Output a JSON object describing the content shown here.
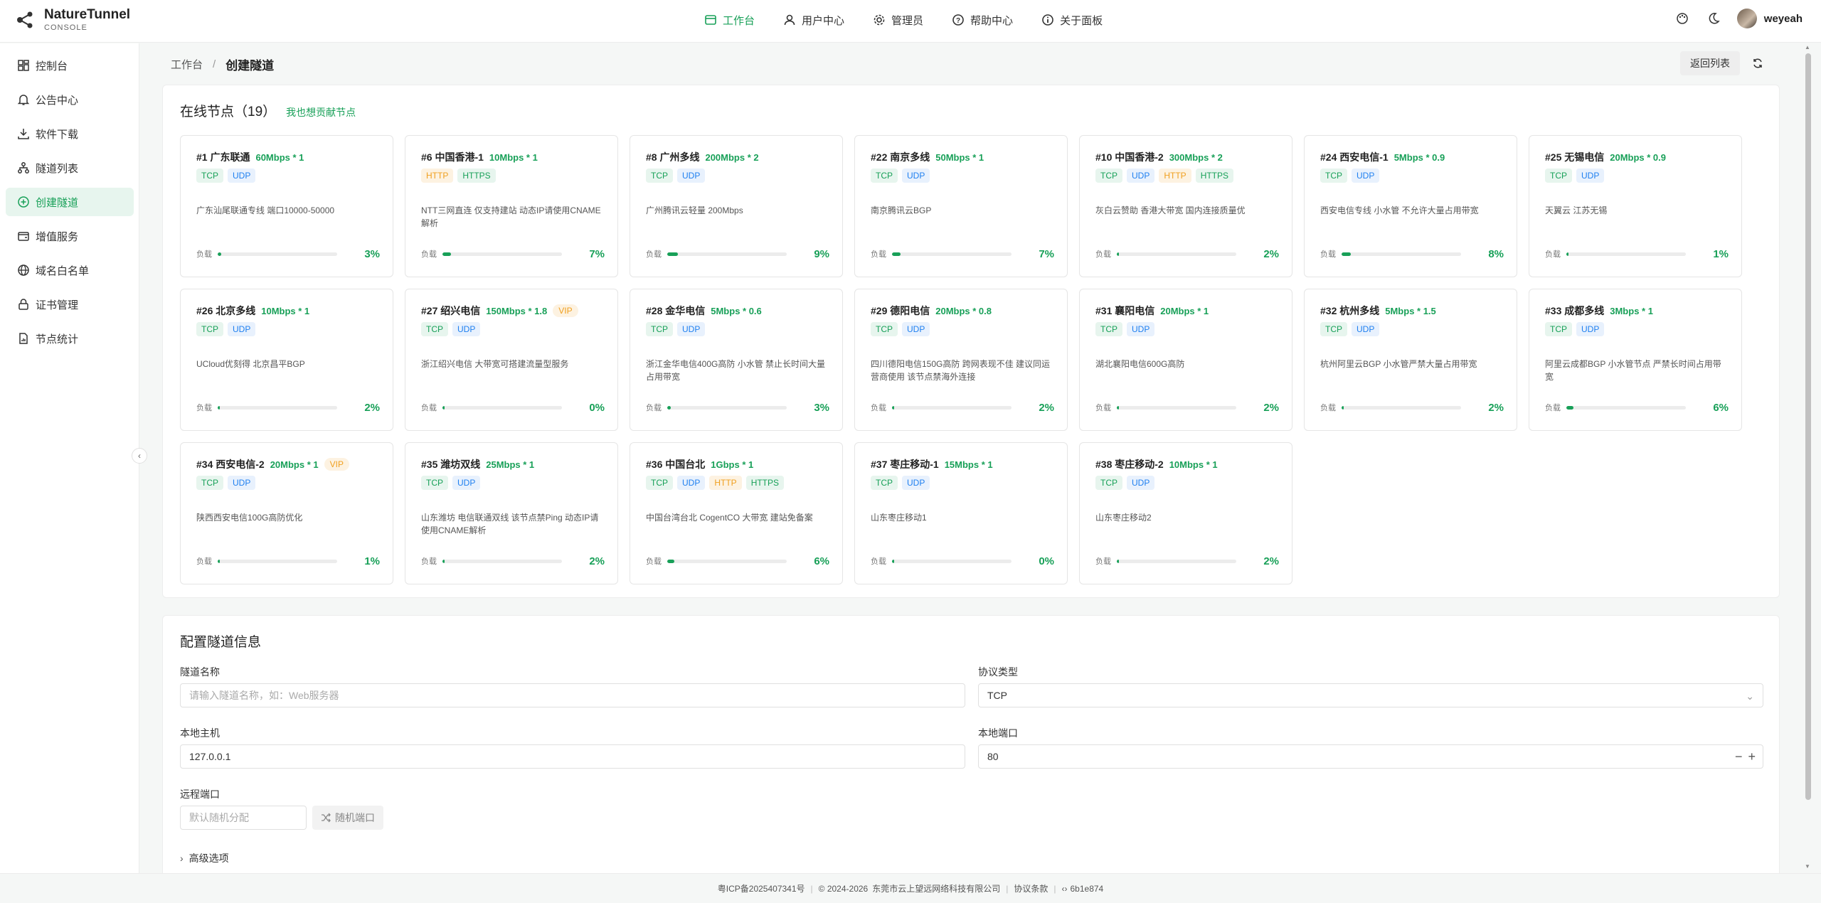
{
  "brand": {
    "name": "NatureTunnel",
    "sub": "CONSOLE"
  },
  "topnav": [
    {
      "label": "工作台",
      "icon": "dashboard-icon",
      "active": true
    },
    {
      "label": "用户中心",
      "icon": "user-icon",
      "active": false
    },
    {
      "label": "管理员",
      "icon": "gear-icon",
      "active": false
    },
    {
      "label": "帮助中心",
      "icon": "help-icon",
      "active": false
    },
    {
      "label": "关于面板",
      "icon": "info-icon",
      "active": false
    }
  ],
  "user": {
    "name": "weyeah"
  },
  "sidebar": {
    "items": [
      {
        "label": "控制台",
        "icon": "grid-icon"
      },
      {
        "label": "公告中心",
        "icon": "bell-icon"
      },
      {
        "label": "软件下载",
        "icon": "download-icon"
      },
      {
        "label": "隧道列表",
        "icon": "tree-icon"
      },
      {
        "label": "创建隧道",
        "icon": "plus-circle-icon",
        "active": true
      },
      {
        "label": "增值服务",
        "icon": "wallet-icon"
      },
      {
        "label": "域名白名单",
        "icon": "globe-icon"
      },
      {
        "label": "证书管理",
        "icon": "lock-icon"
      },
      {
        "label": "节点统计",
        "icon": "file-chart-icon"
      }
    ]
  },
  "breadcrumb": {
    "home": "工作台",
    "sep": "/",
    "current": "创建隧道"
  },
  "actions": {
    "back_label": "返回列表"
  },
  "nodes_section": {
    "title": "在线节点（19）",
    "contribute_link": "我也想贡献节点",
    "load_label": "负载"
  },
  "nodes": [
    {
      "name": "#1 广东联通",
      "bw": "60Mbps * 1",
      "vip": "",
      "tags": [
        "TCP",
        "UDP"
      ],
      "desc": "广东汕尾联通专线 端口10000-50000",
      "load": 3
    },
    {
      "name": "#6 中国香港-1",
      "bw": "10Mbps * 1",
      "vip": "",
      "tags": [
        "HTTP",
        "HTTPS"
      ],
      "desc": "NTT三网直连 仅支持建站 动态IP请使用CNAME解析",
      "load": 7
    },
    {
      "name": "#8 广州多线",
      "bw": "200Mbps * 2",
      "vip": "",
      "tags": [
        "TCP",
        "UDP"
      ],
      "desc": "广州腾讯云轻量 200Mbps",
      "load": 9
    },
    {
      "name": "#22 南京多线",
      "bw": "50Mbps * 1",
      "vip": "",
      "tags": [
        "TCP",
        "UDP"
      ],
      "desc": "南京腾讯云BGP",
      "load": 7
    },
    {
      "name": "#10 中国香港-2",
      "bw": "300Mbps * 2",
      "vip": "",
      "tags": [
        "TCP",
        "UDP",
        "HTTP",
        "HTTPS"
      ],
      "desc": "灰白云赞助 香港大带宽 国内连接质量优",
      "load": 2
    },
    {
      "name": "#24 西安电信-1",
      "bw": "5Mbps * 0.9",
      "vip": "",
      "tags": [
        "TCP",
        "UDP"
      ],
      "desc": "西安电信专线 小水管 不允许大量占用带宽",
      "load": 8
    },
    {
      "name": "#25 无锡电信",
      "bw": "20Mbps * 0.9",
      "vip": "",
      "tags": [
        "TCP",
        "UDP"
      ],
      "desc": "天翼云 江苏无锡",
      "load": 1
    },
    {
      "name": "#26 北京多线",
      "bw": "10Mbps * 1",
      "vip": "",
      "tags": [
        "TCP",
        "UDP"
      ],
      "desc": "UCloud优刻得 北京昌平BGP",
      "load": 2
    },
    {
      "name": "#27 绍兴电信",
      "bw": "150Mbps * 1.8",
      "vip": "VIP",
      "tags": [
        "TCP",
        "UDP"
      ],
      "desc": "浙江绍兴电信 大带宽可搭建流量型服务",
      "load": 0
    },
    {
      "name": "#28 金华电信",
      "bw": "5Mbps * 0.6",
      "vip": "",
      "tags": [
        "TCP",
        "UDP"
      ],
      "desc": "浙江金华电信400G高防 小水管 禁止长时间大量占用带宽",
      "load": 3
    },
    {
      "name": "#29 德阳电信",
      "bw": "20Mbps * 0.8",
      "vip": "",
      "tags": [
        "TCP",
        "UDP"
      ],
      "desc": "四川德阳电信150G高防 跨网表现不佳 建议同运营商使用 该节点禁海外连接",
      "load": 2
    },
    {
      "name": "#31 襄阳电信",
      "bw": "20Mbps * 1",
      "vip": "",
      "tags": [
        "TCP",
        "UDP"
      ],
      "desc": "湖北襄阳电信600G高防",
      "load": 2
    },
    {
      "name": "#32 杭州多线",
      "bw": "5Mbps * 1.5",
      "vip": "",
      "tags": [
        "TCP",
        "UDP"
      ],
      "desc": "杭州阿里云BGP 小水管严禁大量占用带宽",
      "load": 2
    },
    {
      "name": "#33 成都多线",
      "bw": "3Mbps * 1",
      "vip": "",
      "tags": [
        "TCP",
        "UDP"
      ],
      "desc": "阿里云成都BGP 小水管节点 严禁长时间占用带宽",
      "load": 6
    },
    {
      "name": "#34 西安电信-2",
      "bw": "20Mbps * 1",
      "vip": "VIP",
      "tags": [
        "TCP",
        "UDP"
      ],
      "desc": "陕西西安电信100G高防优化",
      "load": 1
    },
    {
      "name": "#35 潍坊双线",
      "bw": "25Mbps * 1",
      "vip": "",
      "tags": [
        "TCP",
        "UDP"
      ],
      "desc": "山东潍坊 电信联通双线 该节点禁Ping 动态IP请使用CNAME解析",
      "load": 2
    },
    {
      "name": "#36 中国台北",
      "bw": "1Gbps * 1",
      "vip": "",
      "tags": [
        "TCP",
        "UDP",
        "HTTP",
        "HTTPS"
      ],
      "desc": "中国台湾台北 CogentCO 大带宽 建站免备案",
      "load": 6
    },
    {
      "name": "#37 枣庄移动-1",
      "bw": "15Mbps * 1",
      "vip": "",
      "tags": [
        "TCP",
        "UDP"
      ],
      "desc": "山东枣庄移动1",
      "load": 0
    },
    {
      "name": "#38 枣庄移动-2",
      "bw": "10Mbps * 1",
      "vip": "",
      "tags": [
        "TCP",
        "UDP"
      ],
      "desc": "山东枣庄移动2",
      "load": 2
    }
  ],
  "config": {
    "title": "配置隧道信息",
    "name_label": "隧道名称",
    "name_placeholder": "请输入隧道名称，如：Web服务器",
    "protocol_label": "协议类型",
    "protocol_value": "TCP",
    "local_host_label": "本地主机",
    "local_host_value": "127.0.0.1",
    "local_port_label": "本地端口",
    "local_port_value": "80",
    "remote_port_label": "远程端口",
    "remote_port_placeholder": "默认随机分配",
    "random_port_label": "随机端口",
    "advanced_label": "高级选项"
  },
  "footer": {
    "icp": "粤ICP备2025407341号",
    "copyright": "© 2024-2026",
    "company": "东莞市云上望远网络科技有限公司",
    "terms": "协议条款",
    "version": "6b1e874"
  },
  "colors": {
    "accent": "#18a058",
    "udp": "#2080f0",
    "http": "#f0a020"
  }
}
